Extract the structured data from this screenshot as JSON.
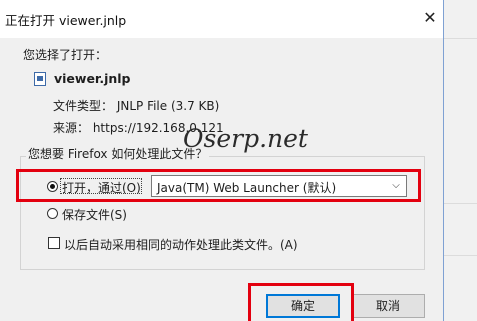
{
  "dialog": {
    "title": "正在打开 viewer.jnlp",
    "close_glyph": "✕",
    "chose_to_open": "您选择了打开：",
    "file_name": "viewer.jnlp",
    "file_type_text": "文件类型： JNLP File (3.7 KB)",
    "source_text": "来源： https://192.168.0.121",
    "question": "您想要 Firefox 如何处理此文件？",
    "open_with_label": "打开，通过(O)",
    "open_with_selected": true,
    "application_value": "Java(TM) Web Launcher (默认)",
    "dropdown_glyph": "⌵",
    "save_file_label": "保存文件(S)",
    "save_file_selected": false,
    "remember_label": "以后自动采用相同的动作处理此类文件。(A)",
    "remember_checked": false,
    "ok_label": "确定",
    "cancel_label": "取消"
  },
  "watermark": "Oserp.net",
  "colors": {
    "highlight": "#e3000f",
    "focus_border": "#0078d7",
    "dialog_bg": "#f0f0f0"
  },
  "icons": {
    "file": "file-icon",
    "close": "close-icon",
    "dropdown": "chevron-down-icon"
  }
}
